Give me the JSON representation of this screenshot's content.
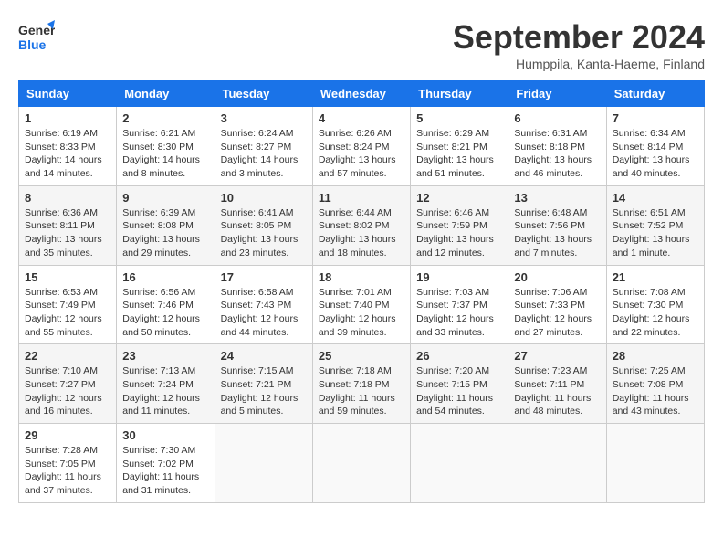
{
  "header": {
    "logo_line1": "General",
    "logo_line2": "Blue",
    "month": "September 2024",
    "location": "Humppila, Kanta-Haeme, Finland"
  },
  "days_of_week": [
    "Sunday",
    "Monday",
    "Tuesday",
    "Wednesday",
    "Thursday",
    "Friday",
    "Saturday"
  ],
  "weeks": [
    [
      {
        "day": "1",
        "sunrise": "Sunrise: 6:19 AM",
        "sunset": "Sunset: 8:33 PM",
        "daylight": "Daylight: 14 hours and 14 minutes."
      },
      {
        "day": "2",
        "sunrise": "Sunrise: 6:21 AM",
        "sunset": "Sunset: 8:30 PM",
        "daylight": "Daylight: 14 hours and 8 minutes."
      },
      {
        "day": "3",
        "sunrise": "Sunrise: 6:24 AM",
        "sunset": "Sunset: 8:27 PM",
        "daylight": "Daylight: 14 hours and 3 minutes."
      },
      {
        "day": "4",
        "sunrise": "Sunrise: 6:26 AM",
        "sunset": "Sunset: 8:24 PM",
        "daylight": "Daylight: 13 hours and 57 minutes."
      },
      {
        "day": "5",
        "sunrise": "Sunrise: 6:29 AM",
        "sunset": "Sunset: 8:21 PM",
        "daylight": "Daylight: 13 hours and 51 minutes."
      },
      {
        "day": "6",
        "sunrise": "Sunrise: 6:31 AM",
        "sunset": "Sunset: 8:18 PM",
        "daylight": "Daylight: 13 hours and 46 minutes."
      },
      {
        "day": "7",
        "sunrise": "Sunrise: 6:34 AM",
        "sunset": "Sunset: 8:14 PM",
        "daylight": "Daylight: 13 hours and 40 minutes."
      }
    ],
    [
      {
        "day": "8",
        "sunrise": "Sunrise: 6:36 AM",
        "sunset": "Sunset: 8:11 PM",
        "daylight": "Daylight: 13 hours and 35 minutes."
      },
      {
        "day": "9",
        "sunrise": "Sunrise: 6:39 AM",
        "sunset": "Sunset: 8:08 PM",
        "daylight": "Daylight: 13 hours and 29 minutes."
      },
      {
        "day": "10",
        "sunrise": "Sunrise: 6:41 AM",
        "sunset": "Sunset: 8:05 PM",
        "daylight": "Daylight: 13 hours and 23 minutes."
      },
      {
        "day": "11",
        "sunrise": "Sunrise: 6:44 AM",
        "sunset": "Sunset: 8:02 PM",
        "daylight": "Daylight: 13 hours and 18 minutes."
      },
      {
        "day": "12",
        "sunrise": "Sunrise: 6:46 AM",
        "sunset": "Sunset: 7:59 PM",
        "daylight": "Daylight: 13 hours and 12 minutes."
      },
      {
        "day": "13",
        "sunrise": "Sunrise: 6:48 AM",
        "sunset": "Sunset: 7:56 PM",
        "daylight": "Daylight: 13 hours and 7 minutes."
      },
      {
        "day": "14",
        "sunrise": "Sunrise: 6:51 AM",
        "sunset": "Sunset: 7:52 PM",
        "daylight": "Daylight: 13 hours and 1 minute."
      }
    ],
    [
      {
        "day": "15",
        "sunrise": "Sunrise: 6:53 AM",
        "sunset": "Sunset: 7:49 PM",
        "daylight": "Daylight: 12 hours and 55 minutes."
      },
      {
        "day": "16",
        "sunrise": "Sunrise: 6:56 AM",
        "sunset": "Sunset: 7:46 PM",
        "daylight": "Daylight: 12 hours and 50 minutes."
      },
      {
        "day": "17",
        "sunrise": "Sunrise: 6:58 AM",
        "sunset": "Sunset: 7:43 PM",
        "daylight": "Daylight: 12 hours and 44 minutes."
      },
      {
        "day": "18",
        "sunrise": "Sunrise: 7:01 AM",
        "sunset": "Sunset: 7:40 PM",
        "daylight": "Daylight: 12 hours and 39 minutes."
      },
      {
        "day": "19",
        "sunrise": "Sunrise: 7:03 AM",
        "sunset": "Sunset: 7:37 PM",
        "daylight": "Daylight: 12 hours and 33 minutes."
      },
      {
        "day": "20",
        "sunrise": "Sunrise: 7:06 AM",
        "sunset": "Sunset: 7:33 PM",
        "daylight": "Daylight: 12 hours and 27 minutes."
      },
      {
        "day": "21",
        "sunrise": "Sunrise: 7:08 AM",
        "sunset": "Sunset: 7:30 PM",
        "daylight": "Daylight: 12 hours and 22 minutes."
      }
    ],
    [
      {
        "day": "22",
        "sunrise": "Sunrise: 7:10 AM",
        "sunset": "Sunset: 7:27 PM",
        "daylight": "Daylight: 12 hours and 16 minutes."
      },
      {
        "day": "23",
        "sunrise": "Sunrise: 7:13 AM",
        "sunset": "Sunset: 7:24 PM",
        "daylight": "Daylight: 12 hours and 11 minutes."
      },
      {
        "day": "24",
        "sunrise": "Sunrise: 7:15 AM",
        "sunset": "Sunset: 7:21 PM",
        "daylight": "Daylight: 12 hours and 5 minutes."
      },
      {
        "day": "25",
        "sunrise": "Sunrise: 7:18 AM",
        "sunset": "Sunset: 7:18 PM",
        "daylight": "Daylight: 11 hours and 59 minutes."
      },
      {
        "day": "26",
        "sunrise": "Sunrise: 7:20 AM",
        "sunset": "Sunset: 7:15 PM",
        "daylight": "Daylight: 11 hours and 54 minutes."
      },
      {
        "day": "27",
        "sunrise": "Sunrise: 7:23 AM",
        "sunset": "Sunset: 7:11 PM",
        "daylight": "Daylight: 11 hours and 48 minutes."
      },
      {
        "day": "28",
        "sunrise": "Sunrise: 7:25 AM",
        "sunset": "Sunset: 7:08 PM",
        "daylight": "Daylight: 11 hours and 43 minutes."
      }
    ],
    [
      {
        "day": "29",
        "sunrise": "Sunrise: 7:28 AM",
        "sunset": "Sunset: 7:05 PM",
        "daylight": "Daylight: 11 hours and 37 minutes."
      },
      {
        "day": "30",
        "sunrise": "Sunrise: 7:30 AM",
        "sunset": "Sunset: 7:02 PM",
        "daylight": "Daylight: 11 hours and 31 minutes."
      },
      null,
      null,
      null,
      null,
      null
    ]
  ]
}
